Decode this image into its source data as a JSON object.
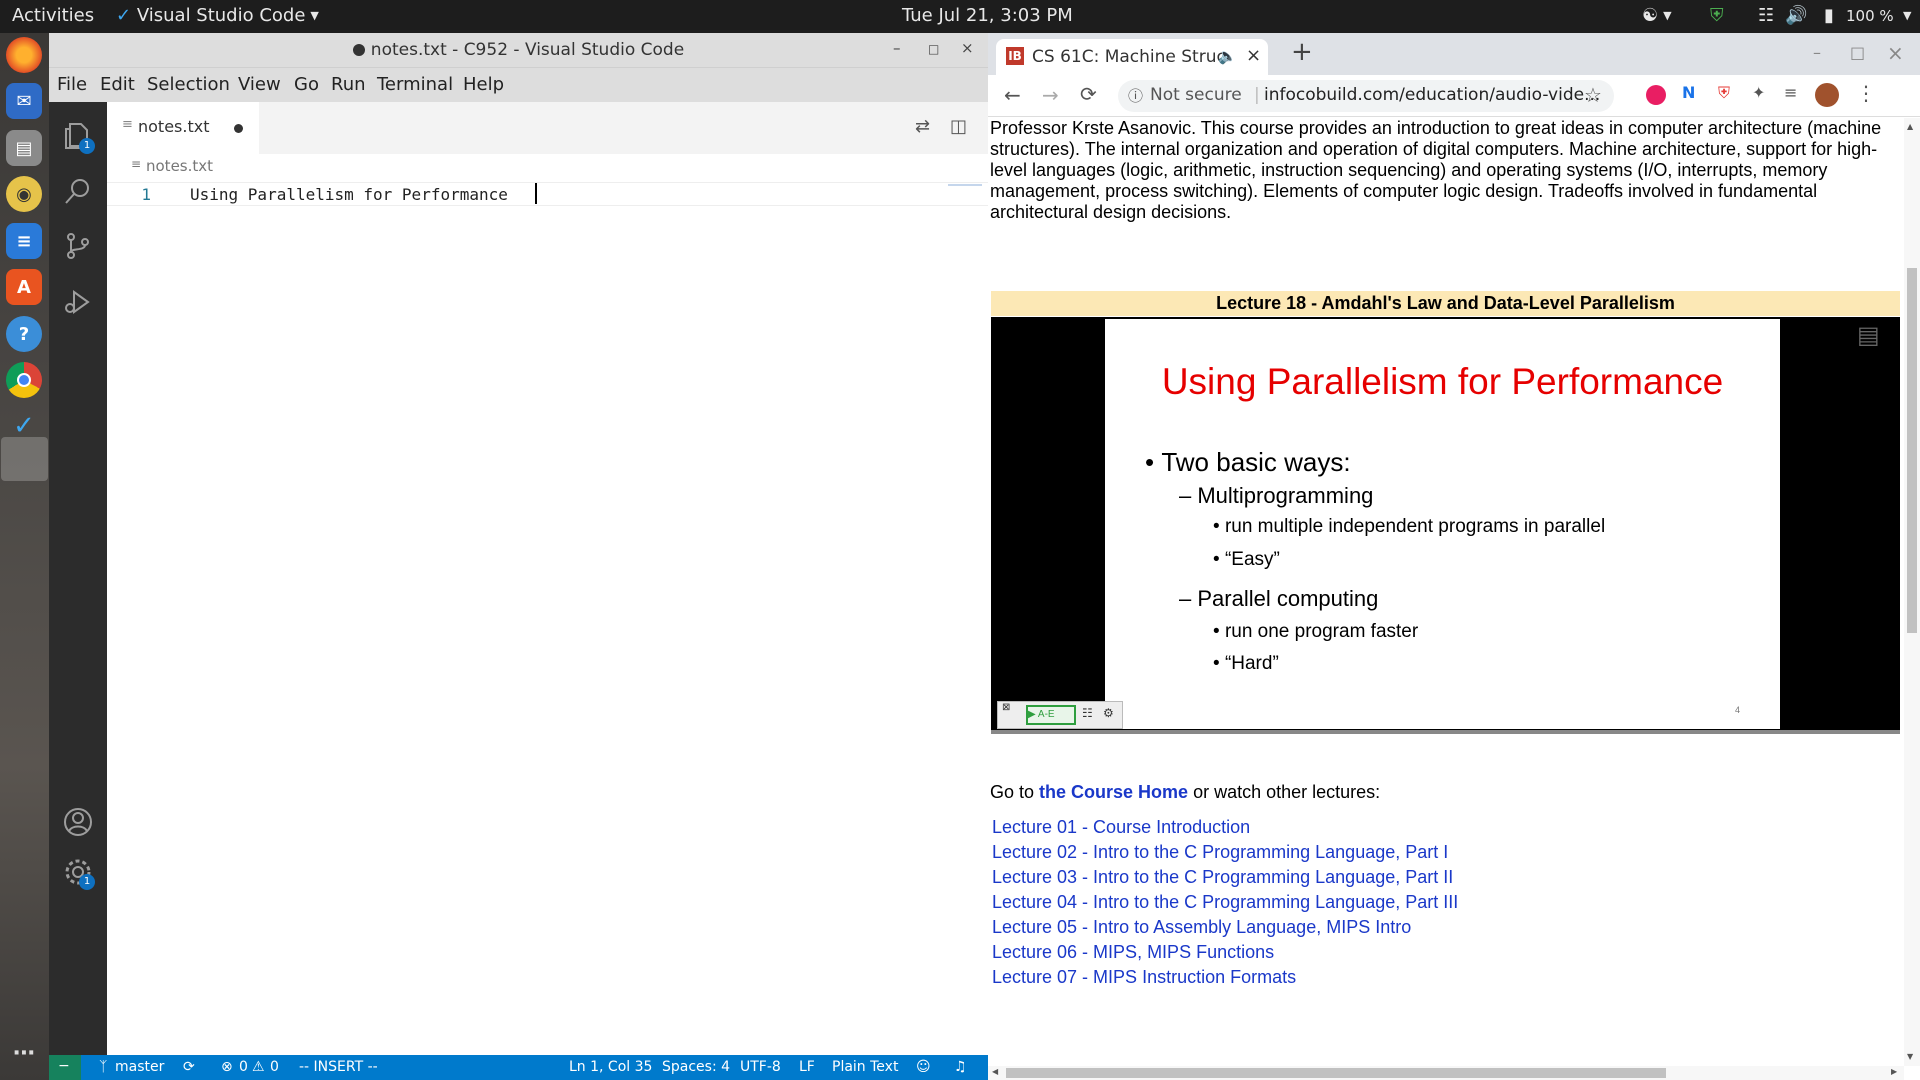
{
  "topbar": {
    "activities": "Activities",
    "app_menu": "Visual Studio Code",
    "clock": "Tue Jul 21,  3:03 PM",
    "battery": "100 %"
  },
  "vscode": {
    "title": "notes.txt - C952 - Visual Studio Code",
    "menu": [
      "File",
      "Edit",
      "Selection",
      "View",
      "Go",
      "Run",
      "Terminal",
      "Help"
    ],
    "tab_label": "notes.txt",
    "breadcrumb": "notes.txt",
    "explorer_badge": "1",
    "settings_badge": "1",
    "lines": [
      {
        "num": "1",
        "text": "Using Parallelism for Performance "
      }
    ],
    "status": {
      "branch": "master",
      "errors": "0",
      "warnings": "0",
      "mode": "-- INSERT --",
      "position": "Ln 1, Col 35",
      "spaces": "Spaces: 4",
      "encoding": "UTF-8",
      "eol": "LF",
      "language": "Plain Text"
    }
  },
  "chrome": {
    "tab_title": "CS 61C: Machine Struc",
    "new_tab": "+",
    "security": "Not secure",
    "url": "infocobuild.com/education/audio-vide...",
    "description": "Professor Krste Asanovic. This course provides an introduction to great ideas in computer architecture (machine structures). The internal organization and operation of digital computers. Machine architecture, support for high-level languages (logic, arithmetic, instruction sequencing) and operating systems (I/O, interrupts, memory management, process switching). Elements of computer logic design. Tradeoffs involved in fundamental architectural design decisions.",
    "lecture_title": "Lecture 18 - Amdahl's Law and Data-Level Parallelism",
    "slide": {
      "title": "Using Parallelism for Performance",
      "bullet": "Two basic ways:",
      "sub1": "Multiprogramming",
      "sub1_items": [
        "run multiple independent programs in parallel",
        "“Easy”"
      ],
      "sub2": "Parallel computing",
      "sub2_items": [
        "run one program faster",
        "“Hard”"
      ],
      "page_num": "4"
    },
    "player_label": "A-E",
    "goto_prefix": "Go to ",
    "goto_link": "the Course Home",
    "goto_suffix": " or watch other lectures:",
    "lectures": [
      "Lecture 01 - Course Introduction",
      "Lecture 02 - Intro to the C Programming Language, Part I",
      "Lecture 03 - Intro to the C Programming Language, Part II",
      "Lecture 04 - Intro to the C Programming Language, Part III",
      "Lecture 05 - Intro to Assembly Language, MIPS Intro",
      "Lecture 06 - MIPS, MIPS Functions",
      "Lecture 07 - MIPS Instruction Formats"
    ]
  }
}
